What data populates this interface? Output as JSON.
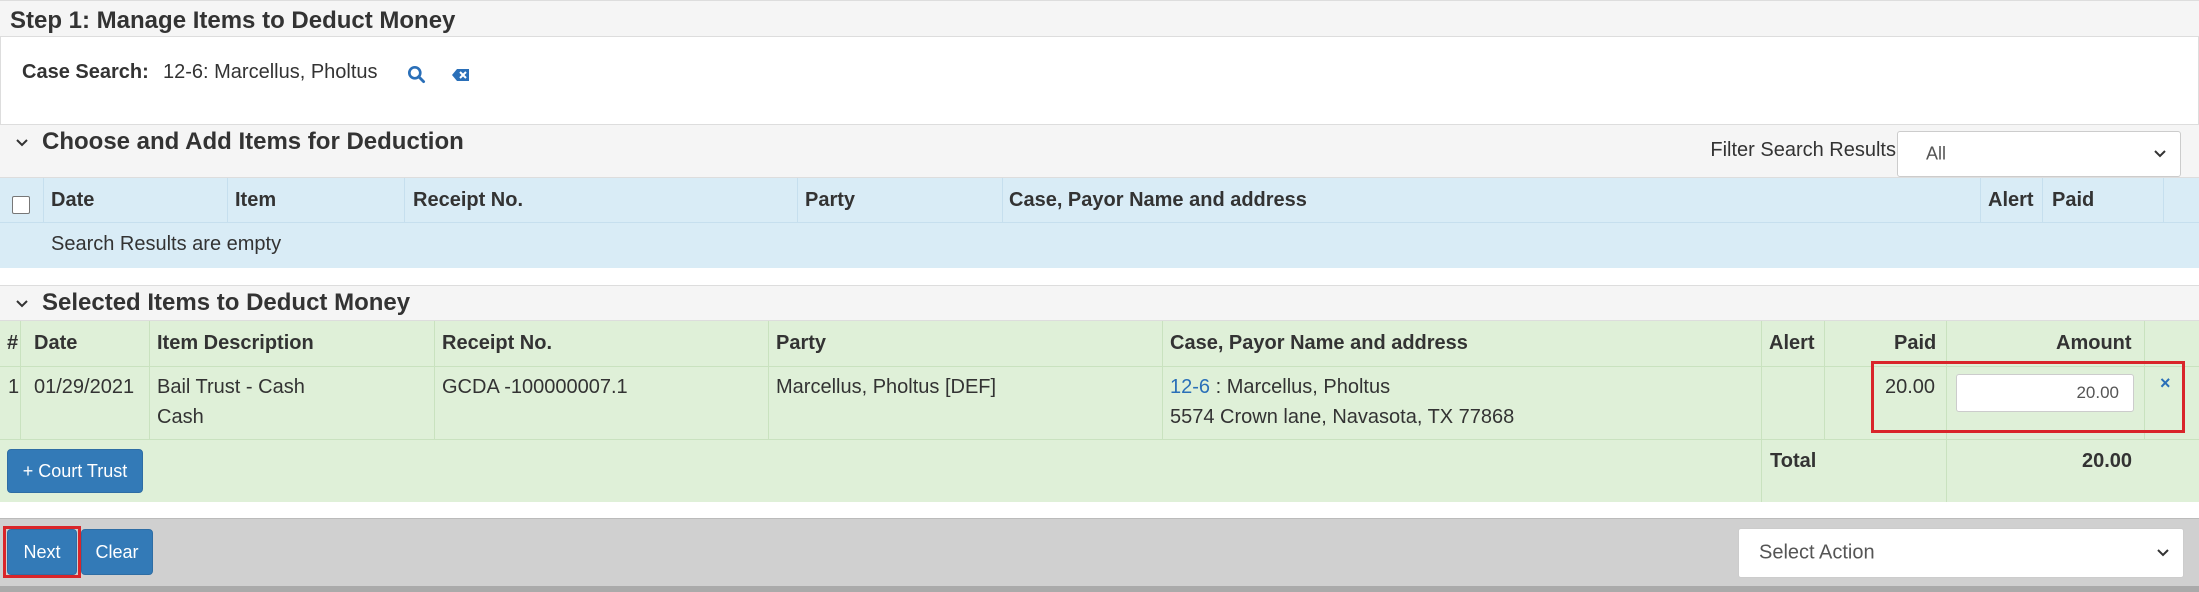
{
  "step": {
    "title": "Step 1: Manage Items to Deduct Money"
  },
  "case_search": {
    "label": "Case Search:",
    "value": "12-6: Marcellus, Pholtus",
    "search_icon": "search-icon",
    "clear_icon": "backspace-icon"
  },
  "choose_section": {
    "title": "Choose and Add Items for Deduction",
    "filter_label": "Filter Search Results",
    "filter_value": "All",
    "columns": [
      "Date",
      "Item",
      "Receipt No.",
      "Party",
      "Case, Payor Name and address",
      "Alert",
      "Paid"
    ],
    "empty_message": "Search Results are empty"
  },
  "selected_section": {
    "title": "Selected Items to Deduct Money",
    "columns": [
      "#",
      "Date",
      "Item Description",
      "Receipt No.",
      "Party",
      "Case, Payor Name and address",
      "Alert",
      "Paid",
      "Amount"
    ],
    "rows": [
      {
        "num": "1",
        "date": "01/29/2021",
        "item_line1": "Bail Trust - Cash",
        "item_line2": "Cash",
        "receipt": "GCDA -100000007.1",
        "party": "Marcellus, Pholtus [DEF]",
        "case_link": "12-6",
        "case_sep": " : ",
        "payor_name": "Marcellus, Pholtus",
        "address": "5574 Crown lane, Navasota, TX 77868",
        "alert": "",
        "paid": "20.00",
        "amount": "20.00",
        "remove": "×"
      }
    ],
    "court_trust_button": "+ Court Trust",
    "total_label": "Total",
    "total_value": "20.00"
  },
  "footer": {
    "next_label": "Next",
    "clear_label": "Clear",
    "action_select": "Select Action"
  },
  "colors": {
    "highlight": "#d9252a",
    "primary": "#337ab7",
    "search_bg": "#d9ecf6",
    "selected_bg": "#dff0d8"
  }
}
